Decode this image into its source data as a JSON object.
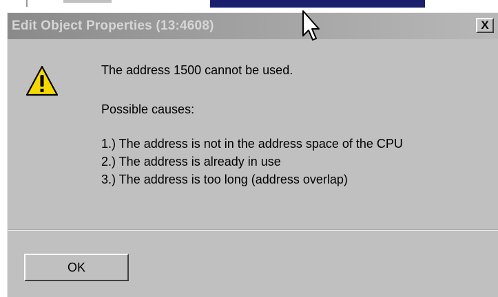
{
  "dialog": {
    "title": "Edit Object Properties (13:4608)",
    "close_label": "X",
    "icon": "warning-icon",
    "messages": [
      "The address 1500 cannot be used.",
      "Possible causes:",
      "1.) The address is not in the address space of the CPU",
      "2.) The address is already in use",
      "3.) The address is too long (address overlap)"
    ],
    "ok_label": "OK"
  },
  "colors": {
    "dialog_bg": "#c0c0c0",
    "titlebar_gradient_start": "#8a8a8a",
    "titlebar_gradient_end": "#b8b8b8",
    "title_text": "#d6d6d6",
    "warning_yellow": "#f5d800",
    "background_window_accent": "#1a1f6e"
  }
}
